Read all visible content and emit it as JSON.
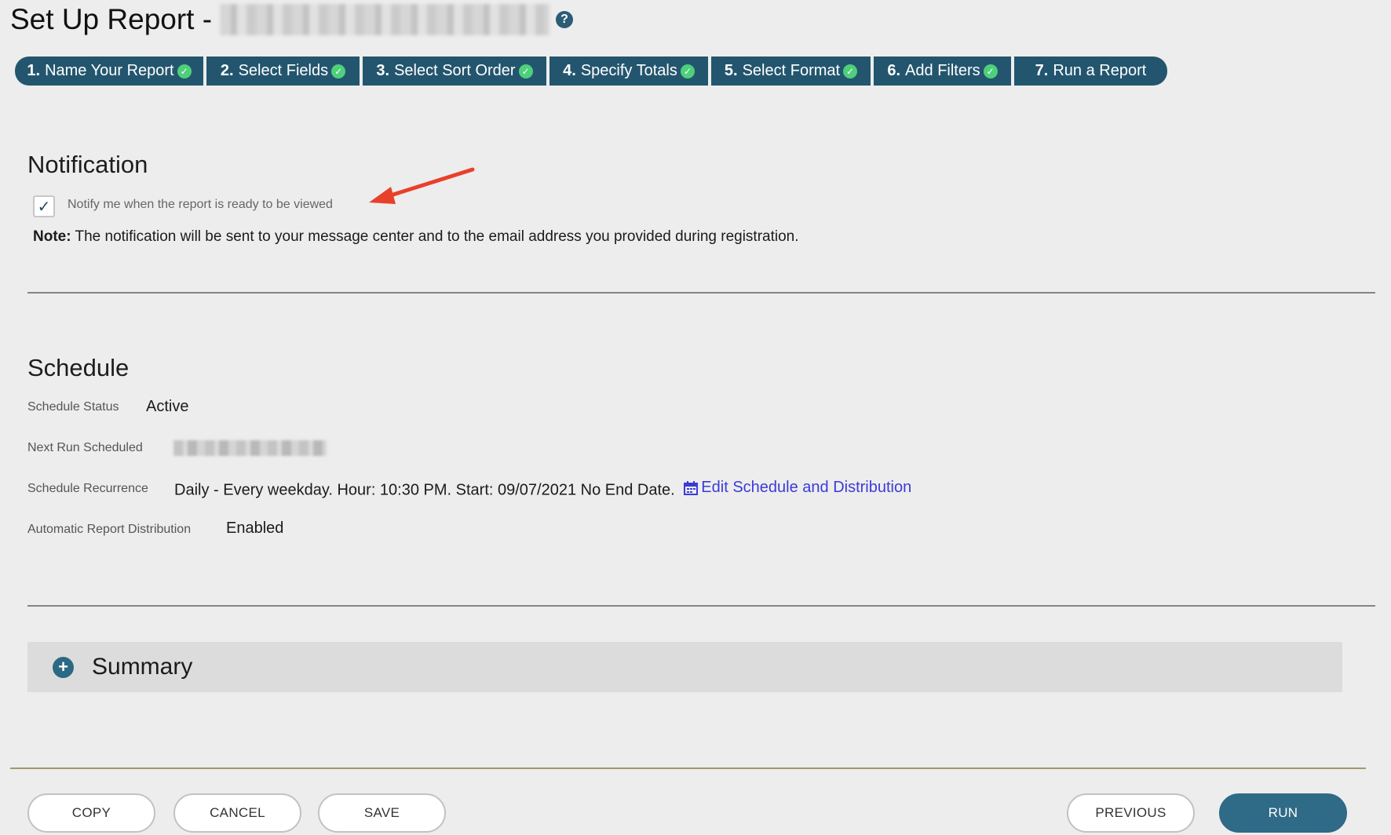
{
  "header": {
    "title": "Set Up Report -",
    "help_icon": "question-icon"
  },
  "steps": [
    {
      "num": "1.",
      "label": "Name Your Report",
      "complete": true
    },
    {
      "num": "2.",
      "label": "Select Fields",
      "complete": true
    },
    {
      "num": "3.",
      "label": "Select Sort Order",
      "complete": true
    },
    {
      "num": "4.",
      "label": "Specify Totals",
      "complete": true
    },
    {
      "num": "5.",
      "label": "Select Format",
      "complete": true
    },
    {
      "num": "6.",
      "label": "Add Filters",
      "complete": true
    },
    {
      "num": "7.",
      "label": "Run a Report",
      "complete": false
    }
  ],
  "notification": {
    "heading": "Notification",
    "checkbox_checked": true,
    "checkbox_label": "Notify me when the report is ready to be viewed",
    "note_bold": "Note:",
    "note_text": " The notification will be sent to your message center and to the email address you provided during registration."
  },
  "schedule": {
    "heading": "Schedule",
    "status_label": "Schedule Status",
    "status_value": "Active",
    "next_run_label": "Next Run Scheduled",
    "recurrence_label": "Schedule Recurrence",
    "recurrence_value": "Daily - Every weekday. Hour: 10:30 PM. Start: 09/07/2021 No End Date.",
    "edit_link": "Edit Schedule and Distribution",
    "distribution_label": "Automatic Report Distribution",
    "distribution_value": "Enabled"
  },
  "summary": {
    "label": "Summary"
  },
  "buttons": {
    "copy": "COPY",
    "cancel": "CANCEL",
    "save": "SAVE",
    "previous": "PREVIOUS",
    "run": "RUN"
  },
  "colors": {
    "step_bg": "#23566e",
    "check_green": "#4ed07b",
    "link_blue": "#3b3bd9",
    "run_button": "#2f6a86",
    "annotation_arrow": "#e8402a"
  }
}
